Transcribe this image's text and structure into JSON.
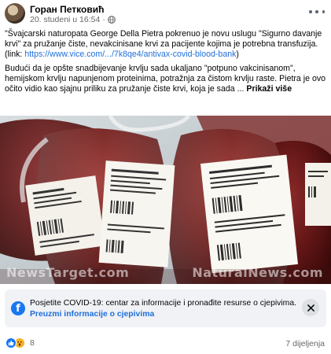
{
  "post": {
    "author": "Горан Петковић",
    "date": "20. studeni u 16:54",
    "separator": "·",
    "paragraph1": "\"Švajcarski naturopata George Della Pietra pokrenuo je novu uslugu \"Sigurno davanje krvi\" za pružanje čiste, nevakcinisane krvi za pacijente kojima je potrebna transfuzija.",
    "link_prefix": "(link: ",
    "link_url": "https://www.vice.com/.../7k8qe4/antivax-covid-blood-bank",
    "link_suffix": ")",
    "paragraph2": "Budući da je opšte snadbijevanje krvlju sada ukaljano \"potpuno vakcinisanom\", hemijskom krvlju napunjenom proteinima, potražnja za čistom krvlju raste. Pietra je ovo očito vidio kao sjajnu priliku za pružanje čiste krvi, koja je sada ...",
    "see_more": "Prikaži više"
  },
  "image": {
    "watermark_left": "NewsTarget.com",
    "watermark_right": "NaturalNews.com"
  },
  "covid_notice": {
    "text": "Posjetite COVID-19: centar za informacije i pronađite resurse o cjepivima.",
    "link": "Preuzmi informacije o cjepivima"
  },
  "footer": {
    "reaction_count": "8",
    "shares": "7 dijeljenja"
  },
  "colors": {
    "link": "#216fdb",
    "facebook_blue": "#1877f2",
    "secondary_text": "#65676b"
  },
  "icons": [
    "globe-icon",
    "more-options-icon",
    "facebook-info-icon",
    "close-icon",
    "like-reaction-icon",
    "wow-reaction-icon"
  ]
}
